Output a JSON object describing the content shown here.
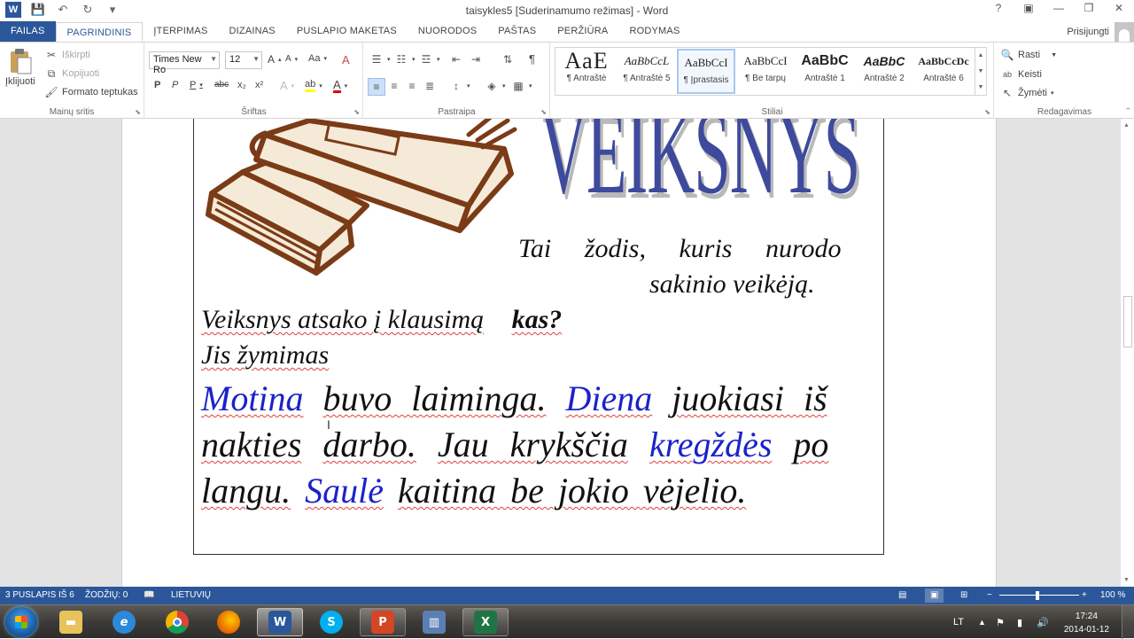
{
  "titlebar": {
    "title": "taisykles5 [Suderinamumo režimas] - Word",
    "help": "?",
    "ribbon_opts": "▣",
    "minimize": "—",
    "restore": "❐",
    "close": "✕"
  },
  "qat": {
    "save": "💾",
    "undo": "↶",
    "redo": "↻",
    "customize": "▾"
  },
  "tabs": [
    "FAILAS",
    "PAGRINDINIS",
    "ĮTERPIMAS",
    "DIZAINAS",
    "PUSLAPIO MAKETAS",
    "NUORODOS",
    "PAŠTAS",
    "PERŽIŪRA",
    "RODYMAS"
  ],
  "user": {
    "name": "Prisijungti"
  },
  "ribbon": {
    "clipboard": {
      "label": "Mainų sritis",
      "paste": "Įklijuoti",
      "cut": "Iškirpti",
      "copy": "Kopijuoti",
      "format_painter": "Formato teptukas"
    },
    "font": {
      "label": "Šriftas",
      "font_name": "Times New Ro",
      "font_size": "12",
      "grow": "A",
      "shrink": "A",
      "case": "Aa",
      "clear": "A",
      "bold": "P",
      "italic": "P",
      "underline": "P",
      "strike": "abc",
      "sub": "x₂",
      "sup": "x²",
      "effects": "A",
      "highlight": "ab",
      "color": "A"
    },
    "paragraph": {
      "label": "Pastraipa",
      "pilcrow": "¶"
    },
    "styles": {
      "label": "Stiliai",
      "items": [
        {
          "sample": "AaE",
          "name": "¶ Antraštė"
        },
        {
          "sample": "AaBbCcL",
          "name": "¶ Antraštė 5"
        },
        {
          "sample": "AaBbCcI",
          "name": "¶ Įprastasis"
        },
        {
          "sample": "AaBbCcI",
          "name": "¶ Be tarpų"
        },
        {
          "sample": "AaBbC",
          "name": "Antraštė 1"
        },
        {
          "sample": "AaBbC",
          "name": "Antraštė 2"
        },
        {
          "sample": "AaBbCcDc",
          "name": "Antraštė 6"
        }
      ]
    },
    "editing": {
      "label": "Redagavimas",
      "find": "Rasti",
      "replace": "Keisti",
      "select": "Žymėti"
    }
  },
  "document": {
    "heading": "VEIKSNYS",
    "definition_line1": "Tai žodis, kuris nurodo",
    "definition_line2": "sakinio veikėją.",
    "question_prefix": "Veiksnys atsako į klausimą",
    "question_word": "kas?",
    "marked": "Jis žymimas",
    "example": {
      "w1": "Motina",
      "w2": "buvo laiminga.",
      "w3": "Diena",
      "w4": "juokiasi iš",
      "w5": "nakties",
      "w6": "darbo.",
      "w7": "Jau krykščia",
      "w8": "kregždės",
      "w9": "po",
      "w10": "langu.",
      "w11": "Saulė",
      "w12": "kaitina be jokio vėjelio."
    }
  },
  "status": {
    "page": "3 PUSLAPIS IŠ 6",
    "words": "ŽODŽIŲ: 0",
    "language": "LIETUVIŲ",
    "zoom": "100 %",
    "zoom_minus": "−",
    "zoom_plus": "+"
  },
  "taskbar": {
    "language": "LT",
    "time": "17:24",
    "date": "2014-01-12"
  },
  "colors": {
    "accent": "#2b579a",
    "heading": "#3e4a9c",
    "subject": "#1a23c8"
  }
}
